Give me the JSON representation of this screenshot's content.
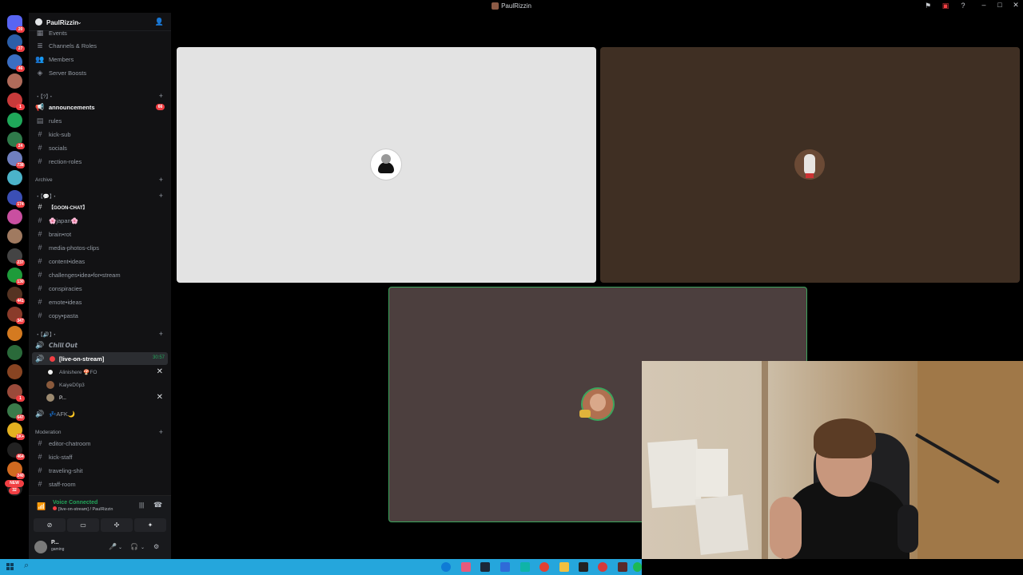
{
  "titlebar": {
    "title": "PaulRizzin"
  },
  "server_rail": {
    "servers": [
      {
        "badge": "20",
        "color": "#5865f2"
      },
      {
        "badge": "27",
        "color": "#2b5ea8"
      },
      {
        "badge": "46",
        "color": "#3a6ec2"
      },
      {
        "badge": "",
        "color": "#b06b5a"
      },
      {
        "badge": "1",
        "color": "#c83a3a"
      },
      {
        "badge": "",
        "color": "#1fa85a"
      },
      {
        "badge": "24",
        "color": "#2f7a4a"
      },
      {
        "badge": "738",
        "color": "#6f7fbf"
      },
      {
        "badge": "",
        "color": "#4bb3c9"
      },
      {
        "badge": "174",
        "color": "#3b4fb5"
      },
      {
        "badge": "",
        "color": "#c94fa0"
      },
      {
        "badge": "",
        "color": "#a07a60"
      },
      {
        "badge": "237",
        "color": "#444"
      },
      {
        "badge": "130",
        "color": "#1e9b3a"
      },
      {
        "badge": "441",
        "color": "#553322"
      },
      {
        "badge": "347",
        "color": "#8a3b2a"
      },
      {
        "badge": "",
        "color": "#d47a20"
      },
      {
        "badge": "",
        "color": "#2a6a3a"
      },
      {
        "badge": "",
        "color": "#884422"
      },
      {
        "badge": "1",
        "color": "#9a4a3a"
      },
      {
        "badge": "647",
        "color": "#3a7a4a"
      },
      {
        "badge": "1K+",
        "color": "#e3b020"
      },
      {
        "badge": "464",
        "color": "#222"
      },
      {
        "badge": "240",
        "color": "#d06a20"
      },
      {
        "badge": "",
        "color": "#222"
      }
    ],
    "new_label": "NEW",
    "new_count": "32"
  },
  "server": {
    "name": "PaulRizzin"
  },
  "top_items": [
    {
      "label": "Events",
      "icon": "calendar-icon"
    },
    {
      "label": "Channels & Roles",
      "icon": "list-icon"
    },
    {
      "label": "Members",
      "icon": "members-icon"
    },
    {
      "label": "Server Boosts",
      "icon": "boost-icon"
    }
  ],
  "categories": {
    "cat1": "・【?】・",
    "archive": "Archive",
    "cat3": "・【💬】・",
    "cat4": "・【🔊】・",
    "moderation": "Moderation"
  },
  "channels": {
    "announcements": {
      "label": "announcements",
      "count": "66"
    },
    "rules": "rules",
    "kick_sub": "kick-sub",
    "socials": "socials",
    "reaction_roles": "rection-roles",
    "goon_chat": "【GOON-CHAT】",
    "japan": "🌸japan🌸",
    "brain_rot": "brain•rot",
    "media": "media-photos-clips",
    "content_ideas": "content•ideas",
    "challenges": "challenges•idea•for•stream",
    "conspiracies": "conspiracies",
    "emote_ideas": "emote•ideas",
    "copy_pasta": "copy•pasta",
    "chill_out": "𝘾𝙝𝙞𝙡𝙡 𝙊𝙪𝙩",
    "live_on_stream": {
      "label": "[live-on-stream]",
      "timer": "30:57"
    },
    "afk": "💤AFK🌙",
    "editor_chatroom": "editor-chatroom",
    "kick_staff": "kick-staff",
    "traveling": "traveling-shit",
    "staff_room": "staff-room"
  },
  "voice_users": [
    {
      "name": "Alinishere 🍄FO",
      "muted": true
    },
    {
      "name": "KaiyeD0p3",
      "muted": false
    },
    {
      "name": "P...",
      "muted": true
    }
  ],
  "voice_panel": {
    "status": "Voice Connected",
    "channel": "[live-on-stream] / PaulRizzin"
  },
  "user_panel": {
    "name": "P...",
    "status": "gaming"
  },
  "tiles": [
    {
      "bg": "#e3e3e3",
      "avatar_color": "#1a1a1a"
    },
    {
      "bg": "#3f2f23",
      "avatar_color": "#8a5a3c"
    },
    {
      "bg": "#4c3f3e",
      "avatar_color": "#b07050",
      "speaking": true
    }
  ]
}
